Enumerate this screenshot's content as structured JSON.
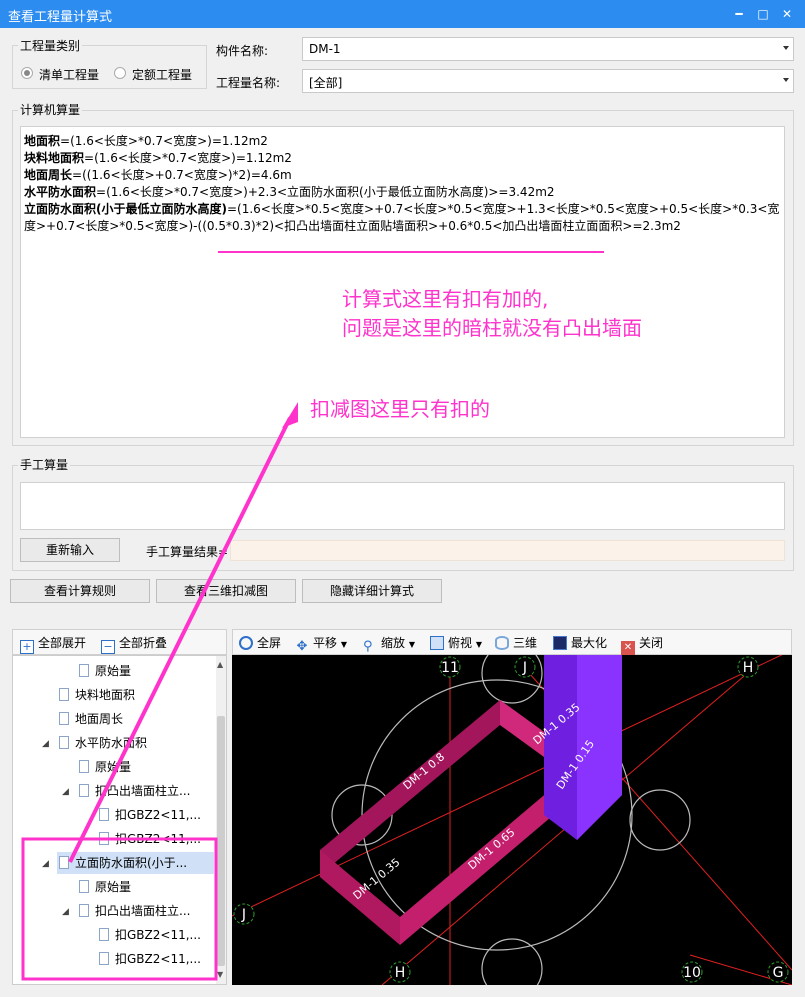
{
  "window": {
    "title": "查看工程量计算式",
    "min": "━",
    "max": "□",
    "close": "✕"
  },
  "category": {
    "label": "工程量类别",
    "opt1": "清单工程量",
    "opt2": "定额工程量"
  },
  "component": {
    "label": "构件名称:",
    "value": "DM-1"
  },
  "quantity": {
    "label": "工程量名称:",
    "value": "[全部]"
  },
  "machine": {
    "label": "计算机算量",
    "lines": [
      {
        "name": "地面积",
        "expr": "=(1.6<长度>*0.7<宽度>)=1.12m2"
      },
      {
        "name": "块料地面积",
        "expr": "=(1.6<长度>*0.7<宽度>)=1.12m2"
      },
      {
        "name": "地面周长",
        "expr": "=((1.6<长度>+0.7<宽度>)*2)=4.6m"
      },
      {
        "name": "水平防水面积",
        "expr": "=(1.6<长度>*0.7<宽度>)+2.3<立面防水面积(小于最低立面防水高度)>=3.42m2"
      },
      {
        "name": "立面防水面积(小于最低立面防水高度)",
        "expr": "=(1.6<长度>*0.5<宽度>+0.7<长度>*0.5<宽度>+1.3<长度>*0.5<宽度>+0.5<长度>*0.3<宽度>+0.7<长度>*0.5<宽度>)-((0.5*0.3)*2)<扣凸出墙面柱立面贴墙面积>+0.6*0.5<加凸出墙面柱立面面积>=2.3m2"
      }
    ]
  },
  "manual": {
    "label": "手工算量",
    "reinput": "重新输入",
    "result_label": "手工算量结果="
  },
  "buttons": {
    "rules": "查看计算规则",
    "view3d": "查看三维扣减图",
    "hide": "隐藏详细计算式"
  },
  "tree_toolbar": {
    "expand": "全部展开",
    "collapse": "全部折叠"
  },
  "tree": [
    {
      "label": "原始量"
    },
    {
      "label": "块料地面积"
    },
    {
      "label": "地面周长"
    },
    {
      "label": "水平防水面积"
    },
    {
      "label": "原始量"
    },
    {
      "label": "扣凸出墙面柱立..."
    },
    {
      "label": "扣GBZ2<11,..."
    },
    {
      "label": "扣GBZ2<11,..."
    },
    {
      "label": "立面防水面积(小于..."
    },
    {
      "label": "原始量"
    },
    {
      "label": "扣凸出墙面柱立..."
    },
    {
      "label": "扣GBZ2<11,..."
    },
    {
      "label": "扣GBZ2<11,..."
    }
  ],
  "view_toolbar": {
    "full": "全屏",
    "pan": "平移",
    "zoom": "缩放",
    "top": "俯视",
    "three_d": "三维",
    "max": "最大化",
    "close": "关闭"
  },
  "view_labels": {
    "g11": "11",
    "gJtop": "J",
    "gH": "H",
    "gJleft": "J",
    "gHbottom": "H",
    "g10": "10",
    "gG": "G",
    "b1": "DM-1 0.35",
    "b2": "DM-1 0.15",
    "b3": "DM-1 0.8",
    "b4": "DM-1 0.65",
    "b5": "DM-1 0.35"
  },
  "annotations": {
    "a1": "计算式这里有扣有加的,",
    "a2": "问题是这里的暗柱就没有凸出墙面",
    "a3": "扣减图这里只有扣的"
  },
  "colors": {
    "title_bg": "#2d8cf0",
    "annotation": "#ff33cc",
    "slab": "#c2186b",
    "column": "#7a1fe6"
  }
}
